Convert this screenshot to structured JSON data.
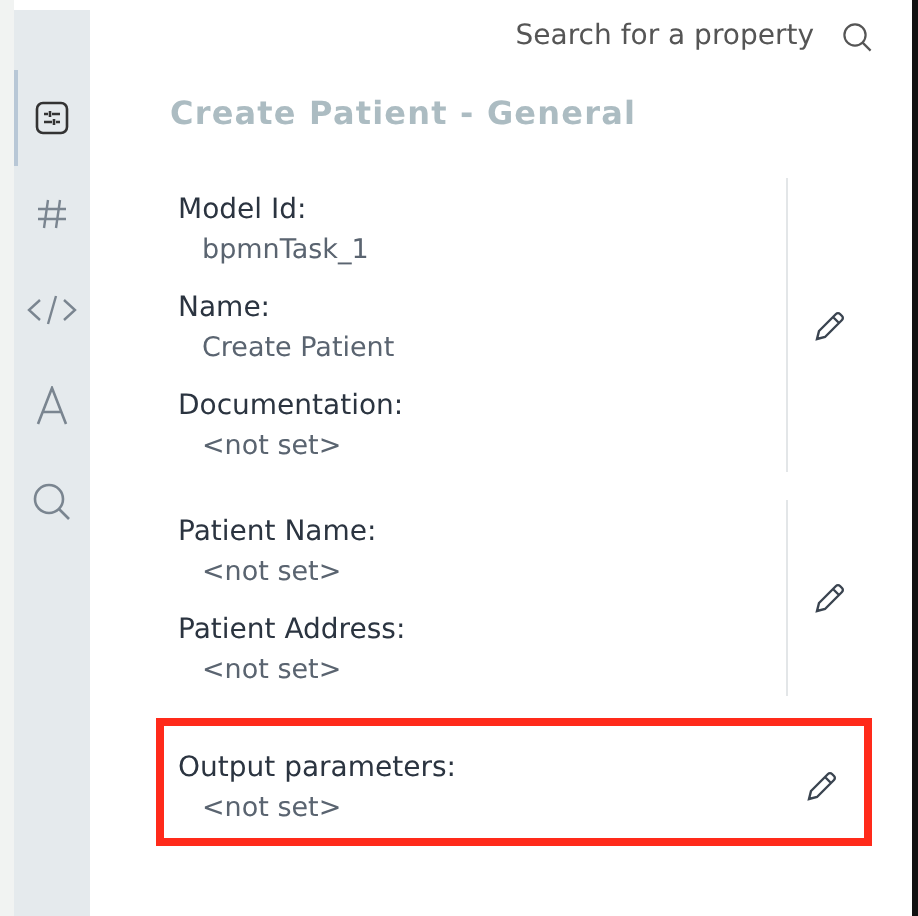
{
  "sidebar": {
    "tabs": [
      {
        "kind": "sliders",
        "selected": true
      },
      {
        "kind": "hash",
        "selected": false
      },
      {
        "kind": "code",
        "selected": false
      },
      {
        "kind": "letter",
        "selected": false
      },
      {
        "kind": "search",
        "selected": false
      }
    ]
  },
  "search": {
    "placeholder": "Search for a property"
  },
  "title": "Create Patient - General",
  "groups": [
    {
      "highlighted": false,
      "fields": [
        {
          "label": "Model Id:",
          "value": "bpmnTask_1"
        },
        {
          "label": "Name:",
          "value": "Create Patient"
        },
        {
          "label": "Documentation:",
          "value": "<not set>"
        }
      ]
    },
    {
      "highlighted": false,
      "fields": [
        {
          "label": "Patient Name:",
          "value": "<not set>"
        },
        {
          "label": "Patient Address:",
          "value": "<not set>"
        }
      ]
    },
    {
      "highlighted": true,
      "fields": [
        {
          "label": "Output parameters:",
          "value": "<not set>"
        }
      ]
    }
  ]
}
